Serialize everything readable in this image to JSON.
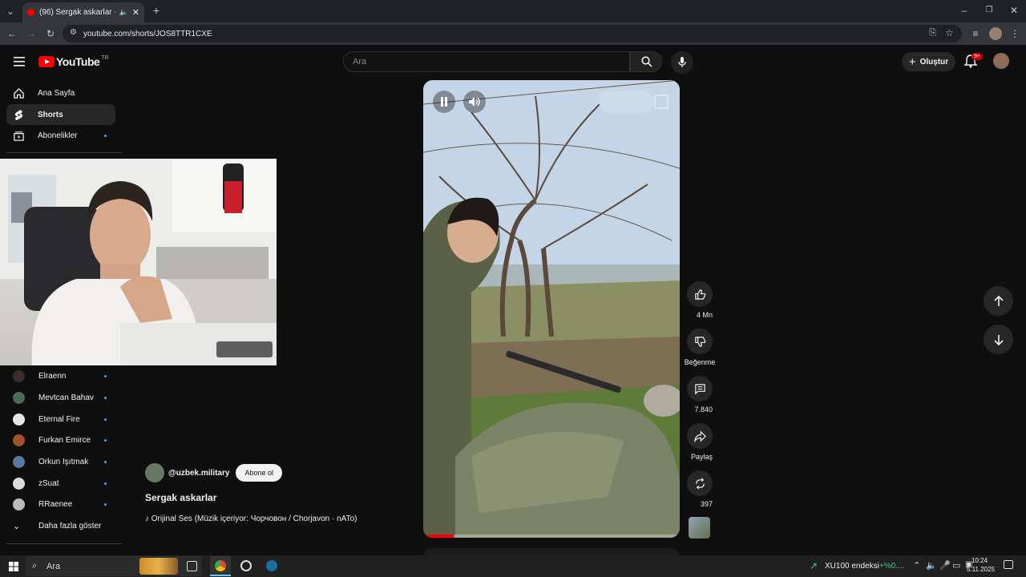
{
  "browser": {
    "tab_title": "(96) Sergak askarlar - YouTube",
    "new_tab": "+",
    "url": "youtube.com/shorts/JOS8TTR1CXE"
  },
  "header": {
    "logo_text": "YouTube",
    "region": "TR",
    "search_placeholder": "Ara",
    "create_label": "Oluştur",
    "notification_count": "9+"
  },
  "sidebar": {
    "items": [
      {
        "label": "Ana Sayfa"
      },
      {
        "label": "Shorts"
      },
      {
        "label": "Abonelikler"
      }
    ],
    "subscriptions": [
      {
        "label": "Elraenn",
        "color": "#3b2e2a"
      },
      {
        "label": "Mevtcan Bahav",
        "color": "#4c6a58"
      },
      {
        "label": "Eternal Fire",
        "color": "#e6e6e6"
      },
      {
        "label": "Furkan Emirce",
        "color": "#a0522d"
      },
      {
        "label": "Orkun Işıtmak",
        "color": "#5c7aa0"
      },
      {
        "label": "zSuat",
        "color": "#dcdcdc"
      },
      {
        "label": "RRaenee",
        "color": "#bbbbbb"
      }
    ],
    "show_more": "Daha fazla göster"
  },
  "short": {
    "channel": "@uzbek.military",
    "subscribe": "Abone ol",
    "title": "Sergak askarlar",
    "music": "Orijinal Ses (Müzik içeriyor: Чорчовон / Chorjavon · nATo)"
  },
  "actions": {
    "likes": "4 Mn",
    "dislike": "Beğenme",
    "comments": "7.840",
    "share": "Paylaş",
    "remix": "397"
  },
  "taskbar": {
    "search": "Ara",
    "ticker": "XU100 endeksi",
    "ticker_change": "+%0....",
    "time": "10:24",
    "date": "5.11.2025"
  },
  "colors": {
    "accent": "#ff0000",
    "ticker_up": "#3fd07a"
  }
}
